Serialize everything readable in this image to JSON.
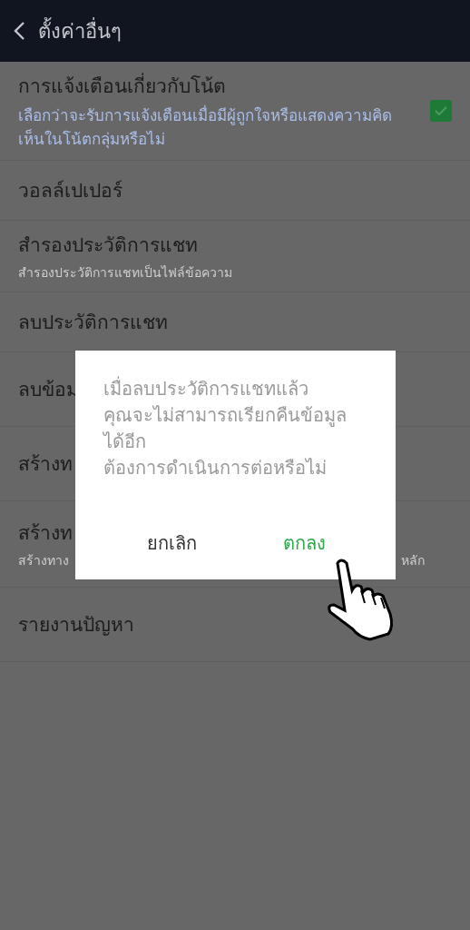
{
  "header": {
    "title": "ตั้งค่าอื่นๆ"
  },
  "settings": [
    {
      "title": "การแจ้งเตือนเกี่ยวกับโน้ต",
      "subtitle": "เลือกว่าจะรับการแจ้งเตือนเมื่อมีผู้ถูกใจหรือแสดงความคิดเห็นในโน้ตกลุ่มหรือไม่",
      "kind": "checkbox",
      "checked": true
    },
    {
      "title": "วอลล์เปเปอร์",
      "kind": "plain"
    },
    {
      "title": "สำรองประวัติการแชท",
      "subtitle": "สำรองประวัติการแชทเป็นไฟล์ข้อความ",
      "kind": "plain"
    },
    {
      "title": "ลบประวัติการแชท",
      "kind": "plain"
    },
    {
      "title": "ลบข้อม",
      "kind": "plain"
    },
    {
      "title": "สร้างท",
      "kind": "plain"
    },
    {
      "title": "สร้างท",
      "subtitle": "สร้างทาง",
      "subtitle_right": "หลัก",
      "kind": "plain"
    },
    {
      "title": "รายงานปัญหา",
      "kind": "plain"
    }
  ],
  "dialog": {
    "message": [
      "เมื่อลบประวัติการแชทแล้ว",
      "คุณจะไม่สามารถเรียกคืนข้อมูล",
      "ได้อีก",
      "ต้องการดำเนินการต่อหรือไม่"
    ],
    "buttons": [
      {
        "label": "ยกเลิก",
        "kind": "cancel"
      },
      {
        "label": "ตกลง",
        "kind": "confirm"
      }
    ]
  }
}
